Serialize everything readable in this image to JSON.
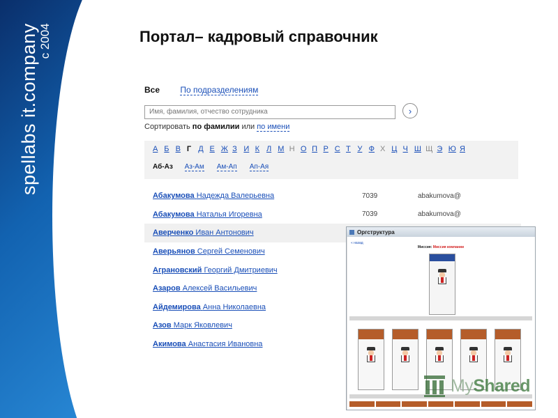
{
  "brand": {
    "name": "spellabs it.company",
    "since": "с 2004"
  },
  "slide_title": "Портал– кадровый справочник",
  "portal": {
    "view_tabs": {
      "all": "Все",
      "by_department": "По подразделениям"
    },
    "search": {
      "placeholder": "Имя, фамилия, отчество сотрудника",
      "go_glyph": "›"
    },
    "sort": {
      "prefix": "Сортировать",
      "by_last_name": "по фамилии",
      "or": "или",
      "by_first_name": "по имени"
    },
    "alphabet": [
      {
        "l": "А",
        "s": "link"
      },
      {
        "l": "Б",
        "s": "link"
      },
      {
        "l": "В",
        "s": "link"
      },
      {
        "l": "Г",
        "s": "current"
      },
      {
        "l": "Д",
        "s": "link"
      },
      {
        "l": "Е",
        "s": "link"
      },
      {
        "l": "Ж",
        "s": "link"
      },
      {
        "l": "З",
        "s": "link"
      },
      {
        "l": "И",
        "s": "link"
      },
      {
        "l": "К",
        "s": "link"
      },
      {
        "l": "Л",
        "s": "link"
      },
      {
        "l": "М",
        "s": "link"
      },
      {
        "l": "Н",
        "s": "dim"
      },
      {
        "l": "О",
        "s": "link"
      },
      {
        "l": "П",
        "s": "link"
      },
      {
        "l": "Р",
        "s": "link"
      },
      {
        "l": "С",
        "s": "link"
      },
      {
        "l": "Т",
        "s": "link"
      },
      {
        "l": "У",
        "s": "link"
      },
      {
        "l": "Ф",
        "s": "link"
      },
      {
        "l": "Х",
        "s": "dim"
      },
      {
        "l": "Ц",
        "s": "link"
      },
      {
        "l": "Ч",
        "s": "link"
      },
      {
        "l": "Ш",
        "s": "link"
      },
      {
        "l": "Щ",
        "s": "dim"
      },
      {
        "l": "Э",
        "s": "link"
      },
      {
        "l": "Ю",
        "s": "link"
      },
      {
        "l": "Я",
        "s": "link"
      }
    ],
    "ranges": {
      "current": "Аб-Аз",
      "links": [
        "Аз-Ам",
        "Ам-Ап",
        "Ап-Ая"
      ]
    },
    "people": [
      {
        "last": "Абакумова",
        "rest": "Надежда Валерьевна",
        "phone": "7039",
        "email": "abakumova@"
      },
      {
        "last": "Абакумова",
        "rest": "Наталья Игоревна",
        "phone": "7039",
        "email": "abakumova@"
      },
      {
        "last": "Аверченко",
        "rest": "Иван Антонович",
        "phone": "",
        "email": ""
      },
      {
        "last": "Аверьянов",
        "rest": "Сергей Семенович",
        "phone": "",
        "email": ""
      },
      {
        "last": "Аграновский",
        "rest": "Георгий Дмитриевич",
        "phone": "",
        "email": ""
      },
      {
        "last": "Азаров",
        "rest": "Алексей Васильевич",
        "phone": "",
        "email": ""
      },
      {
        "last": "Айдемирова",
        "rest": "Анна Николаевна",
        "phone": "",
        "email": ""
      },
      {
        "last": "Азов",
        "rest": "Марк Яковлевич",
        "phone": "",
        "email": ""
      },
      {
        "last": "Акимова",
        "rest": "Анастасия Ивановна",
        "phone": "",
        "email": ""
      }
    ]
  },
  "org_window": {
    "title": "Оргструктура",
    "back": "« назад",
    "mission_label": "Миссия:",
    "mission_value": "Миссия компании"
  },
  "watermark": {
    "prefix": "My",
    "name": "Shared"
  }
}
